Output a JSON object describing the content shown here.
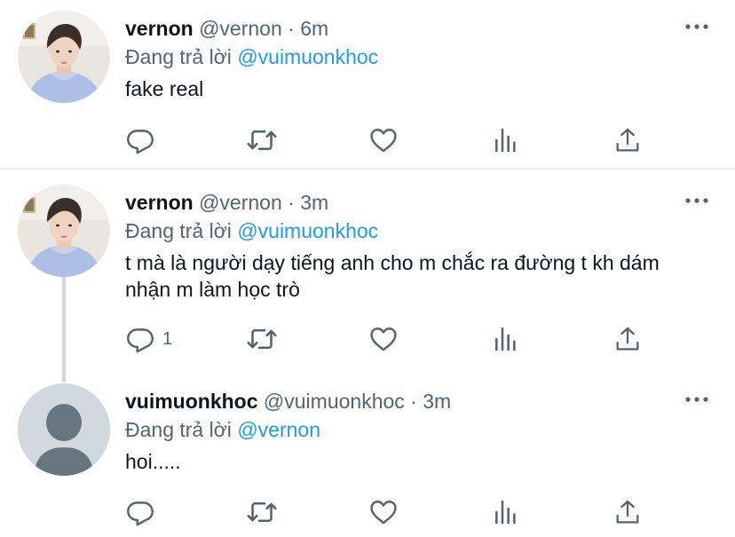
{
  "tweets": [
    {
      "name": "vernon",
      "handle": "@vernon",
      "separator": "·",
      "time": "6m",
      "reply_prefix": "Đang trả lời ",
      "reply_to": "@vuimuonkhoc",
      "text": "fake real",
      "reply_count": "",
      "avatar": "photo"
    },
    {
      "name": "vernon",
      "handle": "@vernon",
      "separator": "·",
      "time": "3m",
      "reply_prefix": "Đang trả lời ",
      "reply_to": "@vuimuonkhoc",
      "text": "t mà là người dạy tiếng anh cho m chắc ra đường t kh dám nhận m làm học trò",
      "reply_count": "1",
      "avatar": "photo"
    },
    {
      "name": "vuimuonkhoc",
      "handle": "@vuimuonkhoc",
      "separator": "·",
      "time": "3m",
      "reply_prefix": "Đang trả lời ",
      "reply_to": "@vernon",
      "text": "hoi.....",
      "reply_count": "",
      "avatar": "default"
    }
  ],
  "icons": {
    "reply": "reply-icon",
    "retweet": "retweet-icon",
    "like": "like-icon",
    "analytics": "analytics-icon",
    "share": "share-icon",
    "more": "more-icon"
  },
  "colors": {
    "mention": "#1d9bf0",
    "secondary_text": "#536471",
    "thread_line": "#cfd9de",
    "default_avatar_bg": "#cfd9de",
    "default_avatar_fg": "#66757f"
  }
}
